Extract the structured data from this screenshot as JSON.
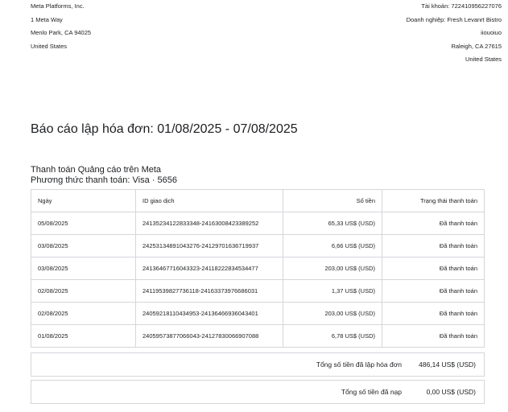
{
  "seller": {
    "lines": [
      "Meta Platforms, Inc.",
      "1 Meta Way",
      "Menlo Park, CA 94025",
      "United States"
    ]
  },
  "buyer": {
    "lines": [
      "Tài khoản: 722410956227076",
      "Doanh nghiệp: Fresh Levanrt Bistro",
      "iiouoiuo",
      "Raleigh, CA 27615",
      "United States"
    ]
  },
  "report_title": "Báo cáo lập hóa đơn: 01/08/2025 - 07/08/2025",
  "section": {
    "heading": "Thanh toán Quảng cáo trên Meta",
    "payment_method": "Phương thức thanh toán: Visa · 5656"
  },
  "table": {
    "headers": [
      "Ngày",
      "ID giao dịch",
      "Số tiền",
      "Trạng thái thanh toán"
    ],
    "rows": [
      [
        "05/08/2025",
        "24135234122833348-24163008423389252",
        "65,33 US$ (USD)",
        "Đã thanh toán"
      ],
      [
        "03/08/2025",
        "24253134891043276-24129701636719937",
        "6,66 US$ (USD)",
        "Đã thanh toán"
      ],
      [
        "03/08/2025",
        "24136467716043323-24118222834534477",
        "203,00 US$ (USD)",
        "Đã thanh toán"
      ],
      [
        "02/08/2025",
        "24119539827736118-24163373976686031",
        "1,37 US$ (USD)",
        "Đã thanh toán"
      ],
      [
        "02/08/2025",
        "24059218110434953-24136466936043401",
        "203,00 US$ (USD)",
        "Đã thanh toán"
      ],
      [
        "01/08/2025",
        "24059573877066043-24127830066907088",
        "6,78 US$ (USD)",
        "Đã thanh toán"
      ]
    ]
  },
  "totals": {
    "billed_label": "Tổng số tiền đã lập hóa đơn",
    "billed_value": "486,14 US$ (USD)",
    "paid_label": "Tổng số tiền đã nạp",
    "paid_value": "0,00 US$ (USD)"
  }
}
